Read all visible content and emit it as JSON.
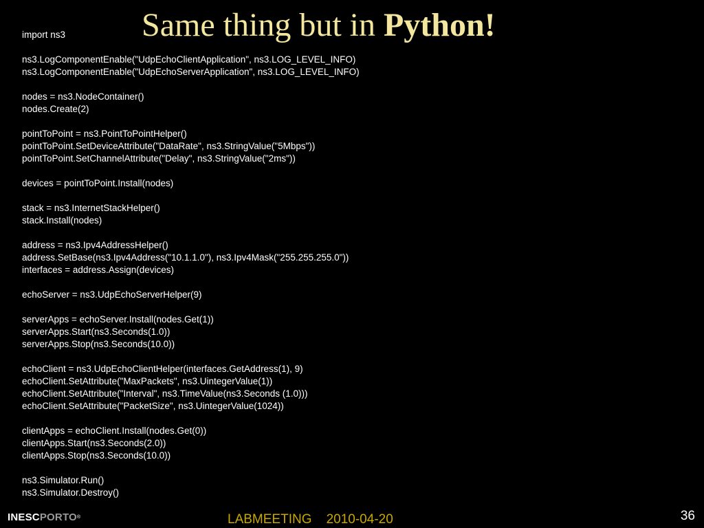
{
  "slide": {
    "title_prefix": "Same thing but in ",
    "title_emphasis": "Python!",
    "code_lines": [
      "import ns3",
      "",
      "ns3.LogComponentEnable(\"UdpEchoClientApplication\", ns3.LOG_LEVEL_INFO)",
      "ns3.LogComponentEnable(\"UdpEchoServerApplication\", ns3.LOG_LEVEL_INFO)",
      "",
      "nodes = ns3.NodeContainer()",
      "nodes.Create(2)",
      "",
      "pointToPoint = ns3.PointToPointHelper()",
      "pointToPoint.SetDeviceAttribute(\"DataRate\", ns3.StringValue(\"5Mbps\"))",
      "pointToPoint.SetChannelAttribute(\"Delay\", ns3.StringValue(\"2ms\"))",
      "",
      "devices = pointToPoint.Install(nodes)",
      "",
      "stack = ns3.InternetStackHelper()",
      "stack.Install(nodes)",
      "",
      "address = ns3.Ipv4AddressHelper()",
      "address.SetBase(ns3.Ipv4Address(\"10.1.1.0\"), ns3.Ipv4Mask(\"255.255.255.0\"))",
      "interfaces = address.Assign(devices)",
      "",
      "echoServer = ns3.UdpEchoServerHelper(9)",
      "",
      "serverApps = echoServer.Install(nodes.Get(1))",
      "serverApps.Start(ns3.Seconds(1.0))",
      "serverApps.Stop(ns3.Seconds(10.0))",
      "",
      "echoClient = ns3.UdpEchoClientHelper(interfaces.GetAddress(1), 9)",
      "echoClient.SetAttribute(\"MaxPackets\", ns3.UintegerValue(1))",
      "echoClient.SetAttribute(\"Interval\", ns3.TimeValue(ns3.Seconds (1.0)))",
      "echoClient.SetAttribute(\"PacketSize\", ns3.UintegerValue(1024))",
      "",
      "clientApps = echoClient.Install(nodes.Get(0))",
      "clientApps.Start(ns3.Seconds(2.0))",
      "clientApps.Stop(ns3.Seconds(10.0))",
      "",
      "ns3.Simulator.Run()",
      "ns3.Simulator.Destroy()"
    ]
  },
  "footer": {
    "logo_part_a": "INESC",
    "logo_part_b": "PORTO",
    "logo_mark": "®",
    "center_text": "LABMEETING    2010-04-20",
    "page_number": "36"
  },
  "colors": {
    "background": "#000000",
    "title": "#f3e7a0",
    "code_text": "#ffffff",
    "footer_center": "#c8a800",
    "logo_secondary": "#9a9a9a"
  }
}
